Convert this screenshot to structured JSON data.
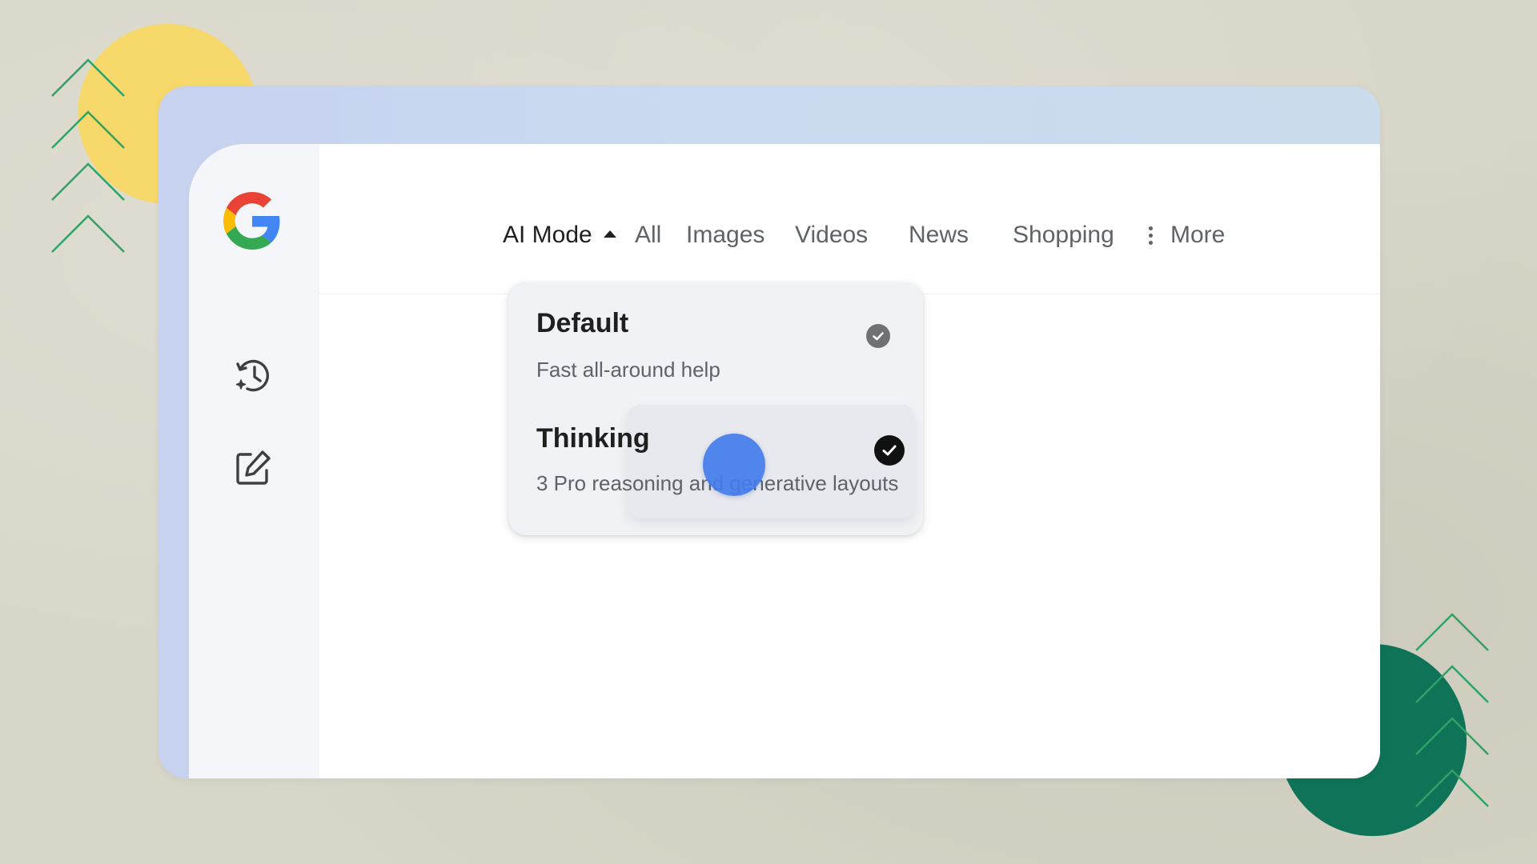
{
  "nav": {
    "items": [
      {
        "label": "AI Mode",
        "active": true
      },
      {
        "label": "All"
      },
      {
        "label": "Images"
      },
      {
        "label": "Videos"
      },
      {
        "label": "News"
      },
      {
        "label": "Shopping"
      },
      {
        "label": "More"
      }
    ]
  },
  "sidebar": {
    "icons": [
      "google-logo",
      "history-sparkle-icon",
      "edit-icon"
    ]
  },
  "dropdown": {
    "options": [
      {
        "title": "Default",
        "description": "Fast all-around help",
        "checked": true,
        "check_style": "gray"
      },
      {
        "title": "Thinking",
        "description": "3 Pro reasoning and generative layouts",
        "checked": true,
        "check_style": "black",
        "hovered": true
      }
    ]
  },
  "colors": {
    "google_blue": "#4285F4",
    "google_red": "#EA4335",
    "google_yellow": "#FBBC05",
    "google_green": "#34A853",
    "touch_indicator": "#427CEC",
    "background": "#D8D6C8",
    "decor_yellow": "#F6D86B",
    "decor_green": "#0F7358"
  }
}
